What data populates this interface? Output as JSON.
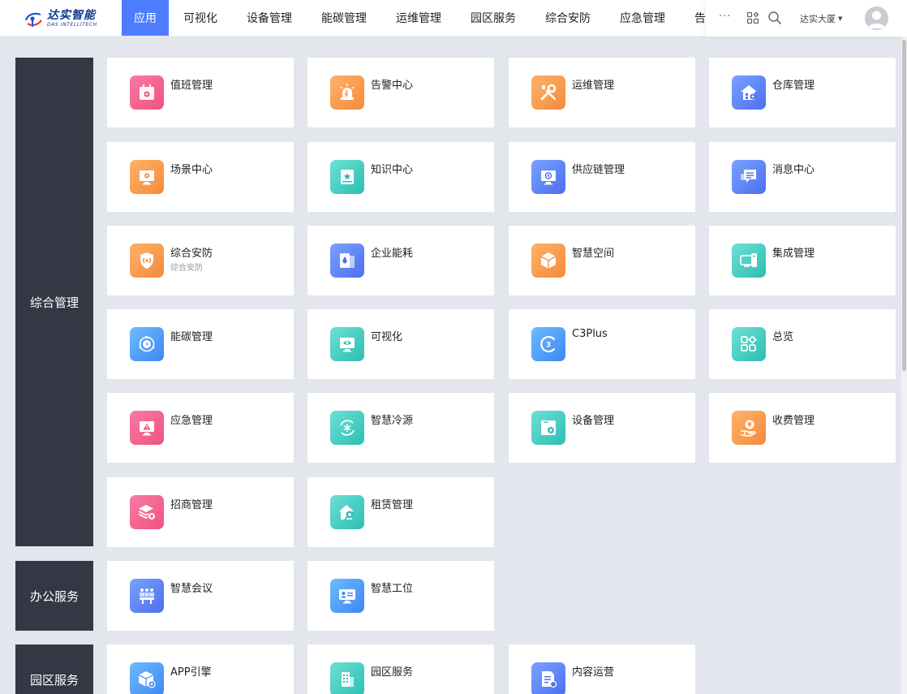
{
  "header": {
    "logo_cn": "达实智能",
    "logo_en": "DAS INTELLITECH",
    "nav": [
      "应用",
      "可视化",
      "设备管理",
      "能碳管理",
      "运维管理",
      "园区服务",
      "综合安防",
      "应急管理",
      "告"
    ],
    "more": "···",
    "user": "达实大厦"
  },
  "sections": [
    {
      "label": "综合管理",
      "apps": [
        {
          "title": "值班管理",
          "icon": "calendar-gear-icon",
          "color": "pink"
        },
        {
          "title": "告警中心",
          "icon": "alarm-light-icon",
          "color": "orange"
        },
        {
          "title": "运维管理",
          "icon": "wrench-screwdriver-icon",
          "color": "orange"
        },
        {
          "title": "仓库管理",
          "icon": "warehouse-gear-icon",
          "color": "blue"
        },
        {
          "title": "场景中心",
          "icon": "monitor-gear-icon",
          "color": "orange"
        },
        {
          "title": "知识中心",
          "icon": "book-star-icon",
          "color": "teal"
        },
        {
          "title": "供应链管理",
          "icon": "monitor-target-icon",
          "color": "blue"
        },
        {
          "title": "消息中心",
          "icon": "chat-bubbles-icon",
          "color": "blue"
        },
        {
          "title": "综合安防",
          "subtitle": "综合安防",
          "icon": "shield-signal-icon",
          "color": "orange"
        },
        {
          "title": "企业能耗",
          "icon": "drop-stack-icon",
          "color": "blue"
        },
        {
          "title": "智慧空间",
          "icon": "cube-icon",
          "color": "orange"
        },
        {
          "title": "集成管理",
          "icon": "devices-icon",
          "color": "teal"
        },
        {
          "title": "能碳管理",
          "icon": "energy-orbit-icon",
          "color": "sky"
        },
        {
          "title": "可视化",
          "icon": "monitor-eye-icon",
          "color": "teal"
        },
        {
          "title": "C3Plus",
          "icon": "c3-icon",
          "color": "sky"
        },
        {
          "title": "总览",
          "icon": "grid-overview-icon",
          "color": "teal"
        },
        {
          "title": "应急管理",
          "icon": "monitor-warning-icon",
          "color": "pink"
        },
        {
          "title": "智慧冷源",
          "icon": "snowflake-cycle-icon",
          "color": "teal"
        },
        {
          "title": "设备管理",
          "icon": "window-gear-icon",
          "color": "teal"
        },
        {
          "title": "收费管理",
          "icon": "hand-coin-icon",
          "color": "orange"
        },
        {
          "title": "招商管理",
          "icon": "layers-coin-icon",
          "color": "pink"
        },
        {
          "title": "租赁管理",
          "icon": "house-key-icon",
          "color": "teal"
        }
      ]
    },
    {
      "label": "办公服务",
      "apps": [
        {
          "title": "智慧会议",
          "icon": "meeting-icon",
          "color": "blue"
        },
        {
          "title": "智慧工位",
          "icon": "workstation-icon",
          "color": "sky"
        }
      ]
    },
    {
      "label": "园区服务",
      "apps": [
        {
          "title": "APP引擎",
          "icon": "box-gear-icon",
          "color": "sky"
        },
        {
          "title": "园区服务",
          "icon": "building-icon",
          "color": "teal"
        },
        {
          "title": "内容运营",
          "icon": "document-edit-icon",
          "color": "blue"
        }
      ]
    }
  ]
}
